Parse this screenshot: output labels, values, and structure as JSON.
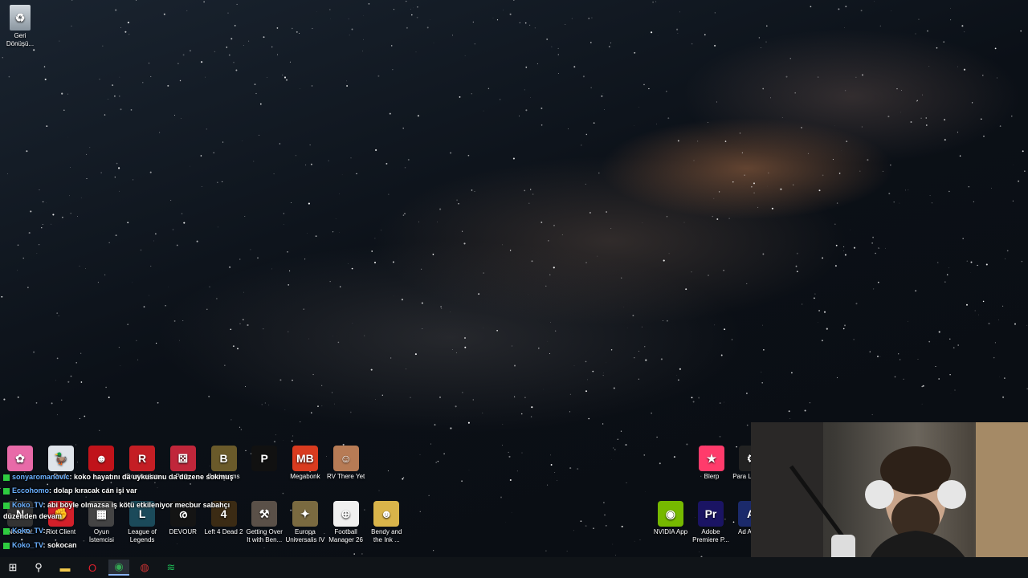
{
  "desktop": {
    "recycle_bin": {
      "label": "Geri Dönüşü..."
    },
    "row1": [
      {
        "label": "",
        "color": "#e86aa8",
        "glyph": "✿"
      },
      {
        "label": "Duck",
        "color": "#dfe4ea",
        "glyph": "🦆"
      },
      {
        "label": "",
        "color": "#c0131a",
        "glyph": "☻"
      },
      {
        "label": "Domination",
        "color": "#c41e24",
        "glyph": "R"
      },
      {
        "label": "Party",
        "color": "#c0263a",
        "glyph": "⚄"
      },
      {
        "label": "Backrooms",
        "color": "#6a5a2a",
        "glyph": "B"
      },
      {
        "label": "",
        "color": "#111111",
        "glyph": "P"
      },
      {
        "label": "Megabonk",
        "color": "#d93b1f",
        "glyph": "MB"
      },
      {
        "label": "RV There Yet",
        "color": "#b77b55",
        "glyph": "☺"
      }
    ],
    "row2": [
      {
        "label": "Need for",
        "color": "#333333",
        "glyph": "N"
      },
      {
        "label": "Riot Client",
        "color": "#d3202a",
        "glyph": "✊"
      },
      {
        "label": "Oyun İstemcisi",
        "color": "#444444",
        "glyph": "▦"
      },
      {
        "label": "League of Legends",
        "color": "#1b4a5a",
        "glyph": "L"
      },
      {
        "label": "DEVOUR",
        "color": "#141414",
        "glyph": "ര"
      },
      {
        "label": "Left 4 Dead 2",
        "color": "#3b2b14",
        "glyph": "4"
      },
      {
        "label": "Getting Over It with Ben...",
        "color": "#5a5048",
        "glyph": "⚒"
      },
      {
        "label": "Europa Universalis IV",
        "color": "#7a6a40",
        "glyph": "✦"
      },
      {
        "label": "Football Manager 26",
        "color": "#f0f0f0",
        "glyph": "⊕"
      },
      {
        "label": "Bendy and the Ink ...",
        "color": "#d9b44a",
        "glyph": "☻"
      }
    ],
    "right_row1": [
      {
        "label": "Blerp",
        "color": "#ff3b6b",
        "glyph": "★"
      },
      {
        "label": "Para Launc...",
        "color": "#222222",
        "glyph": "⚙"
      }
    ],
    "right_row2": [
      {
        "label": "NVIDIA App",
        "color": "#76b900",
        "glyph": "◉"
      },
      {
        "label": "Adobe Premiere P...",
        "color": "#1a1463",
        "glyph": "Pr"
      },
      {
        "label": "Ad Auc...",
        "color": "#1b2a6b",
        "glyph": "A"
      }
    ]
  },
  "chat": [
    {
      "user": "sonyaromanovic",
      "text": ": koko hayatını da uykusunu da düzene sokmuş"
    },
    {
      "user": "Eccohomo",
      "text": ": dolap kıracak can işi var"
    },
    {
      "user": "Koko_TV",
      "text": ": abi böyle olmazsa iş kötü etkileniyor mecbur sabahçı"
    },
    {
      "user": "",
      "text": "düzenden devam"
    },
    {
      "user": "Koko_TV",
      "text": ":"
    },
    {
      "user": "Koko_TV",
      "text": ": sokocan"
    }
  ],
  "taskbar": {
    "items": [
      {
        "name": "start-button",
        "glyph": "⊞",
        "color": "#ffffff"
      },
      {
        "name": "search-icon",
        "glyph": "⚲",
        "color": "#ffffff"
      },
      {
        "name": "file-explorer-icon",
        "glyph": "▬",
        "color": "#f2c94c"
      },
      {
        "name": "opera-icon",
        "glyph": "O",
        "color": "#e0202c"
      },
      {
        "name": "chrome-icon",
        "glyph": "◉",
        "color": "#34a853"
      },
      {
        "name": "app-icon",
        "glyph": "◍",
        "color": "#cc3333"
      },
      {
        "name": "spotify-icon",
        "glyph": "≋",
        "color": "#1db954"
      }
    ]
  }
}
